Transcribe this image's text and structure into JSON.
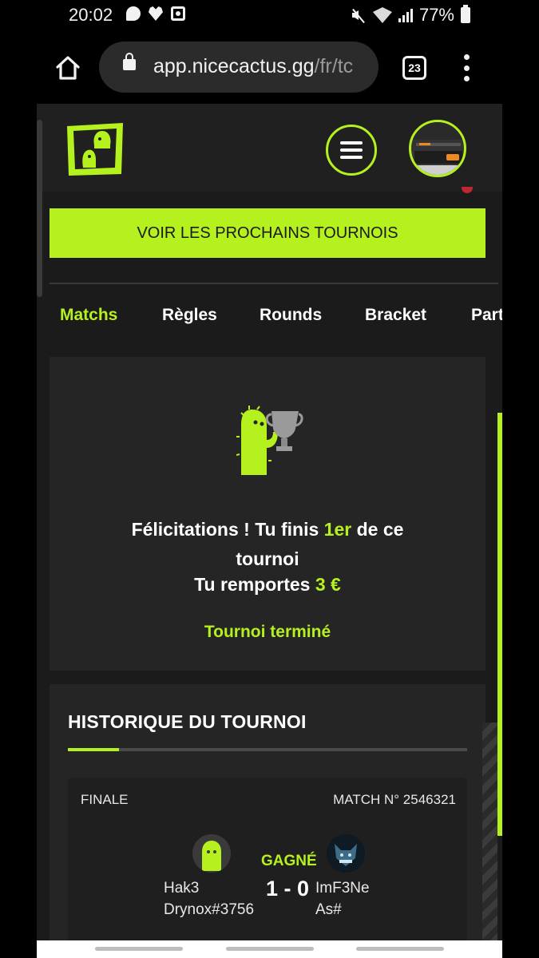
{
  "status_bar": {
    "time": "20:02",
    "battery": "77%",
    "icons": [
      "message-icon",
      "heart-icon",
      "app-notification-icon",
      "mute-icon",
      "wifi-icon",
      "signal-icon",
      "battery-icon"
    ]
  },
  "browser": {
    "url_main": "app.nicecactus.gg",
    "url_path": "/fr/tc",
    "tab_count": "23"
  },
  "site": {
    "accent_color": "#b5f01f",
    "cta_label": "VOIR LES PROCHAINS TOURNOIS",
    "tabs": [
      {
        "label": "Matchs",
        "active": true
      },
      {
        "label": "Règles"
      },
      {
        "label": "Rounds"
      },
      {
        "label": "Bracket"
      },
      {
        "label": "Part"
      }
    ]
  },
  "result": {
    "line1_prefix": "Félicitations ! Tu finis ",
    "rank": "1er",
    "line1_suffix": " de ce",
    "line2": "tournoi",
    "prize_prefix": "Tu remportes ",
    "prize": "3 €",
    "status": "Tournoi terminé"
  },
  "history": {
    "title": "HISTORIQUE DU TOURNOI",
    "match": {
      "round": "FINALE",
      "match_id": "MATCH N° 2546321",
      "result": "GAGNÉ",
      "score": "1 - 0",
      "player1_line1": "Hak3",
      "player1_line2": "Drynox#3756",
      "player2_line1": "ImF3Ne",
      "player2_line2": "As#"
    }
  }
}
